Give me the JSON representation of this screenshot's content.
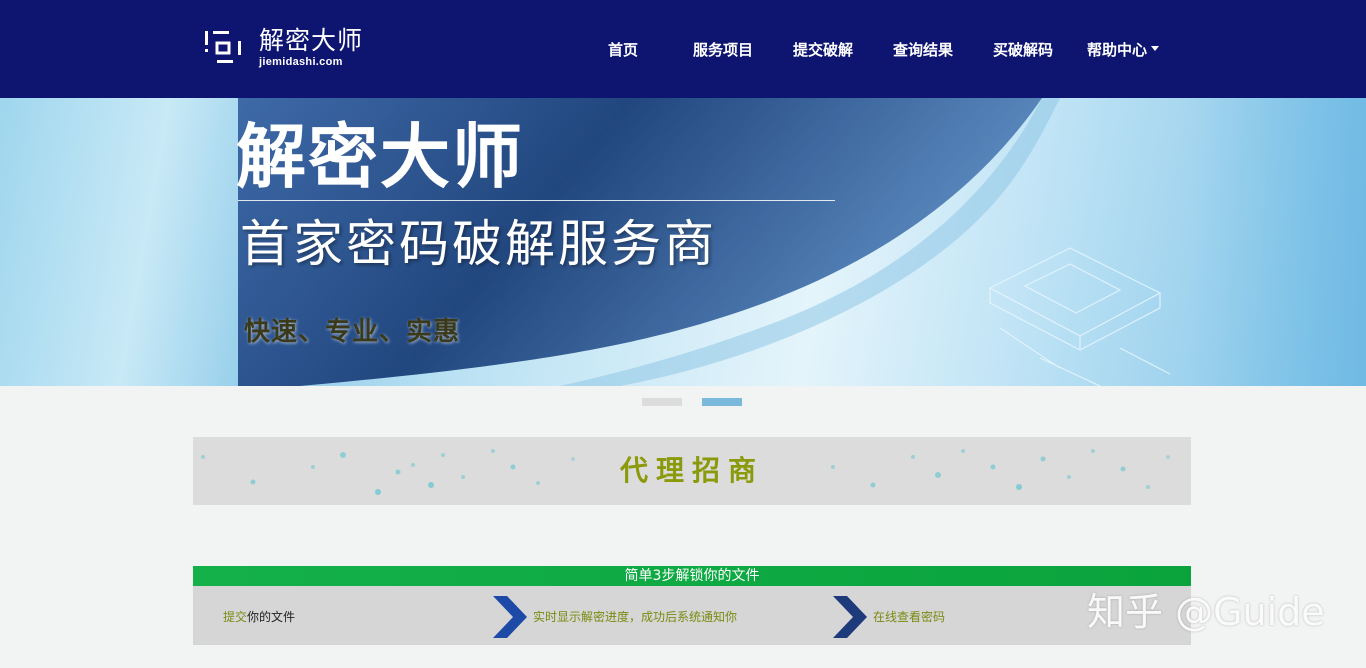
{
  "logo": {
    "cn": "解密大师",
    "en": "jiemidashi.com"
  },
  "nav": {
    "items": [
      {
        "label": "首页"
      },
      {
        "label": "服务项目"
      },
      {
        "label": "提交破解"
      },
      {
        "label": "查询结果"
      },
      {
        "label": "买破解码"
      },
      {
        "label": "帮助中心"
      }
    ]
  },
  "banner": {
    "title": "解密大师",
    "subtitle": "首家密码破解服务商",
    "tagline": "快速、专业、实惠"
  },
  "carousel": {
    "active_index": 2,
    "count": 2
  },
  "agent": {
    "label": "代理招商"
  },
  "steps": {
    "heading": "简单3步解锁你的文件",
    "step1_highlight": "提交",
    "step1_rest": "你的文件",
    "step2": "实时显示解密进度，成功后系统通知你",
    "step3": "在线查看密码"
  },
  "watermark": "知乎 @Guide",
  "colors": {
    "header_bg": "#0e1570",
    "steps_green": "#14b04a",
    "accent_olive": "#8a9a0a",
    "chevron_blue": "#1d4aa6"
  }
}
